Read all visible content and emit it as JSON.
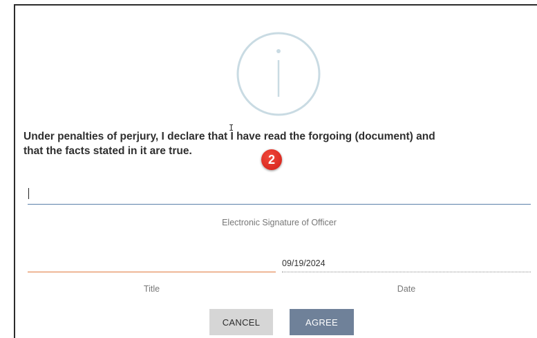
{
  "icons": {
    "info": "info-icon"
  },
  "statement": {
    "line1": "Under penalties of perjury, I declare that I have read the forgoing (document) and",
    "line2": "that the facts stated in it are true."
  },
  "annotation": {
    "step_number": "2"
  },
  "signature": {
    "value": "",
    "label": "Electronic Signature of Officer"
  },
  "title_field": {
    "value": "",
    "label": "Title"
  },
  "date_field": {
    "value": "09/19/2024",
    "label": "Date"
  },
  "buttons": {
    "cancel": "CANCEL",
    "agree": "AGREE"
  },
  "colors": {
    "signature_underline": "#5a7fa8",
    "title_underline": "#e0783c",
    "agree_button": "#6f8199",
    "cancel_button": "#d6d6d6",
    "badge": "#e53935",
    "info_icon": "#c9dbe3"
  }
}
